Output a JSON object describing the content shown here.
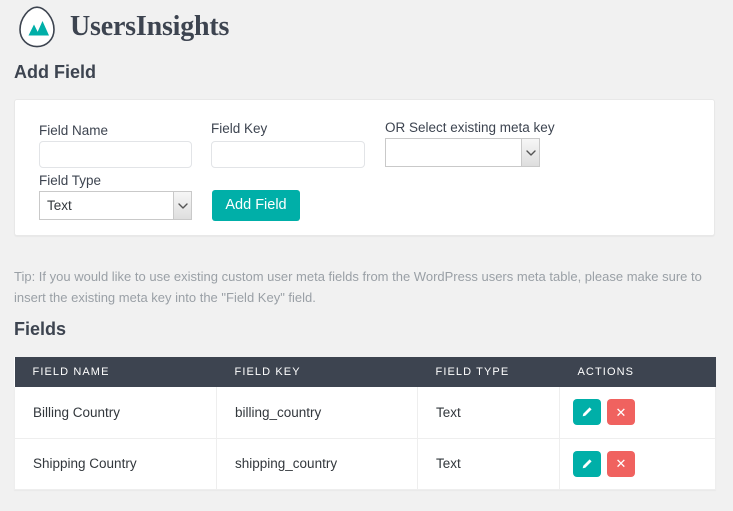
{
  "brand": {
    "name": "UsersInsights",
    "logo_icon": "mountain-logo-icon",
    "accent_color": "#00afa8",
    "dark_color": "#3d4450"
  },
  "add_field": {
    "title": "Add Field",
    "field_name": {
      "label": "Field Name",
      "value": "",
      "placeholder": ""
    },
    "field_key": {
      "label": "Field Key",
      "value": "",
      "placeholder": ""
    },
    "meta_key_select": {
      "label": "OR Select existing meta key",
      "value": ""
    },
    "field_type_select": {
      "label": "Field Type",
      "value": "Text"
    },
    "submit_label": "Add Field"
  },
  "tip": {
    "text": "Tip: If you would like to use existing custom user meta fields from the WordPress users meta table, please make sure to insert the existing meta key into the \"Field Key\" field."
  },
  "fields_section": {
    "title": "Fields",
    "columns": [
      "FIELD NAME",
      "FIELD KEY",
      "FIELD TYPE",
      "ACTIONS"
    ],
    "rows": [
      {
        "field_name": "Billing Country",
        "field_key": "billing_country",
        "field_type": "Text",
        "edit_icon": "pencil-icon",
        "delete_icon": "close-x-icon"
      },
      {
        "field_name": "Shipping Country",
        "field_key": "shipping_country",
        "field_type": "Text",
        "edit_icon": "pencil-icon",
        "delete_icon": "close-x-icon"
      }
    ]
  }
}
